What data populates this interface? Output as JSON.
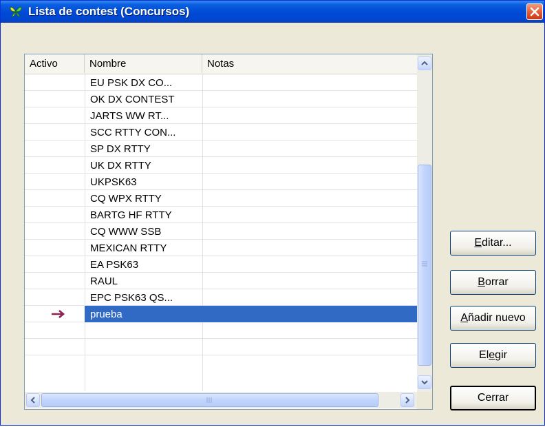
{
  "window": {
    "title": "Lista de contest (Concursos)",
    "icon": "butterfly-icon",
    "close_icon": "close-icon"
  },
  "listview": {
    "columns": [
      "Activo",
      "Nombre",
      "Notas"
    ],
    "rows": [
      {
        "activo": "",
        "nombre": "EU PSK DX CO...",
        "notas": ""
      },
      {
        "activo": "",
        "nombre": "OK DX CONTEST",
        "notas": ""
      },
      {
        "activo": "",
        "nombre": "JARTS WW RT...",
        "notas": ""
      },
      {
        "activo": "",
        "nombre": "SCC RTTY CON...",
        "notas": ""
      },
      {
        "activo": "",
        "nombre": "SP DX RTTY",
        "notas": ""
      },
      {
        "activo": "",
        "nombre": "UK DX RTTY",
        "notas": ""
      },
      {
        "activo": "",
        "nombre": "UKPSK63",
        "notas": ""
      },
      {
        "activo": "",
        "nombre": "CQ WPX RTTY",
        "notas": ""
      },
      {
        "activo": "",
        "nombre": "BARTG HF RTTY",
        "notas": ""
      },
      {
        "activo": "",
        "nombre": "CQ WWW SSB",
        "notas": ""
      },
      {
        "activo": "",
        "nombre": "MEXICAN RTTY",
        "notas": ""
      },
      {
        "activo": "",
        "nombre": "EA PSK63",
        "notas": ""
      },
      {
        "activo": "",
        "nombre": "RAUL",
        "notas": ""
      },
      {
        "activo": "",
        "nombre": "EPC PSK63 QS...",
        "notas": ""
      },
      {
        "activo": "arrow-right-icon",
        "nombre": "prueba",
        "notas": "",
        "selected": true
      },
      {
        "activo": "",
        "nombre": "",
        "notas": ""
      },
      {
        "activo": "",
        "nombre": "",
        "notas": ""
      }
    ],
    "vertical_scroll_position": 0.72
  },
  "buttons": {
    "editar": "Editar...",
    "borrar": "Borrar",
    "anadir": "Añadir nuevo",
    "elegir": "Elegir",
    "cerrar": "Cerrar"
  },
  "colors": {
    "titlebar": "#0050d8",
    "selection": "#316ac5",
    "arrow": "#8b2252",
    "dialog_bg": "#ece9d8"
  }
}
